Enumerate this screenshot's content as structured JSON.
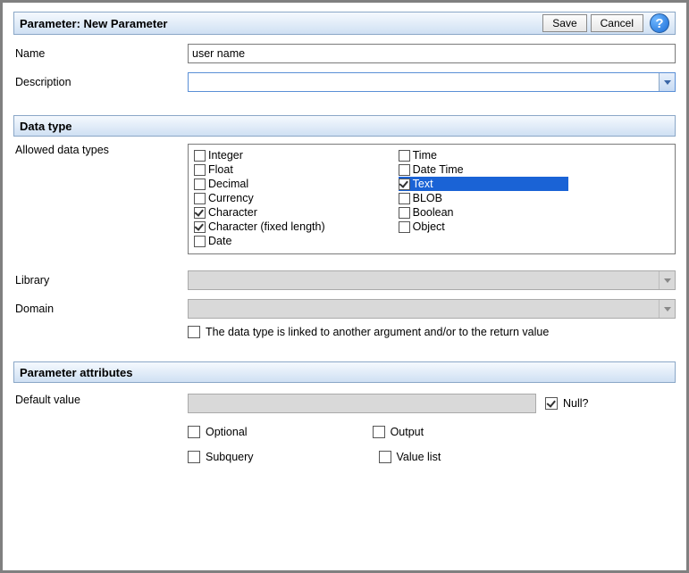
{
  "header": {
    "title": "Parameter: New Parameter",
    "save_label": "Save",
    "cancel_label": "Cancel"
  },
  "fields": {
    "name_label": "Name",
    "name_value": "user name",
    "description_label": "Description"
  },
  "datatype": {
    "section_label": "Data type",
    "allowed_label": "Allowed data types",
    "col1": [
      {
        "label": "Integer",
        "checked": false,
        "selected": false
      },
      {
        "label": "Float",
        "checked": false,
        "selected": false
      },
      {
        "label": "Decimal",
        "checked": false,
        "selected": false
      },
      {
        "label": "Currency",
        "checked": false,
        "selected": false
      },
      {
        "label": "Character",
        "checked": true,
        "selected": false
      },
      {
        "label": "Character (fixed length)",
        "checked": true,
        "selected": false
      },
      {
        "label": "Date",
        "checked": false,
        "selected": false
      }
    ],
    "col2": [
      {
        "label": "Time",
        "checked": false,
        "selected": false
      },
      {
        "label": "Date Time",
        "checked": false,
        "selected": false
      },
      {
        "label": "Text",
        "checked": true,
        "selected": true
      },
      {
        "label": "BLOB",
        "checked": false,
        "selected": false
      },
      {
        "label": "Boolean",
        "checked": false,
        "selected": false
      },
      {
        "label": "Object",
        "checked": false,
        "selected": false
      }
    ],
    "library_label": "Library",
    "domain_label": "Domain",
    "linked_label": "The data type is linked to another argument and/or to the return value"
  },
  "attributes": {
    "section_label": "Parameter attributes",
    "default_label": "Default value",
    "null_label": "Null?",
    "null_checked": true,
    "optional_label": "Optional",
    "output_label": "Output",
    "subquery_label": "Subquery",
    "valuelist_label": "Value list"
  }
}
